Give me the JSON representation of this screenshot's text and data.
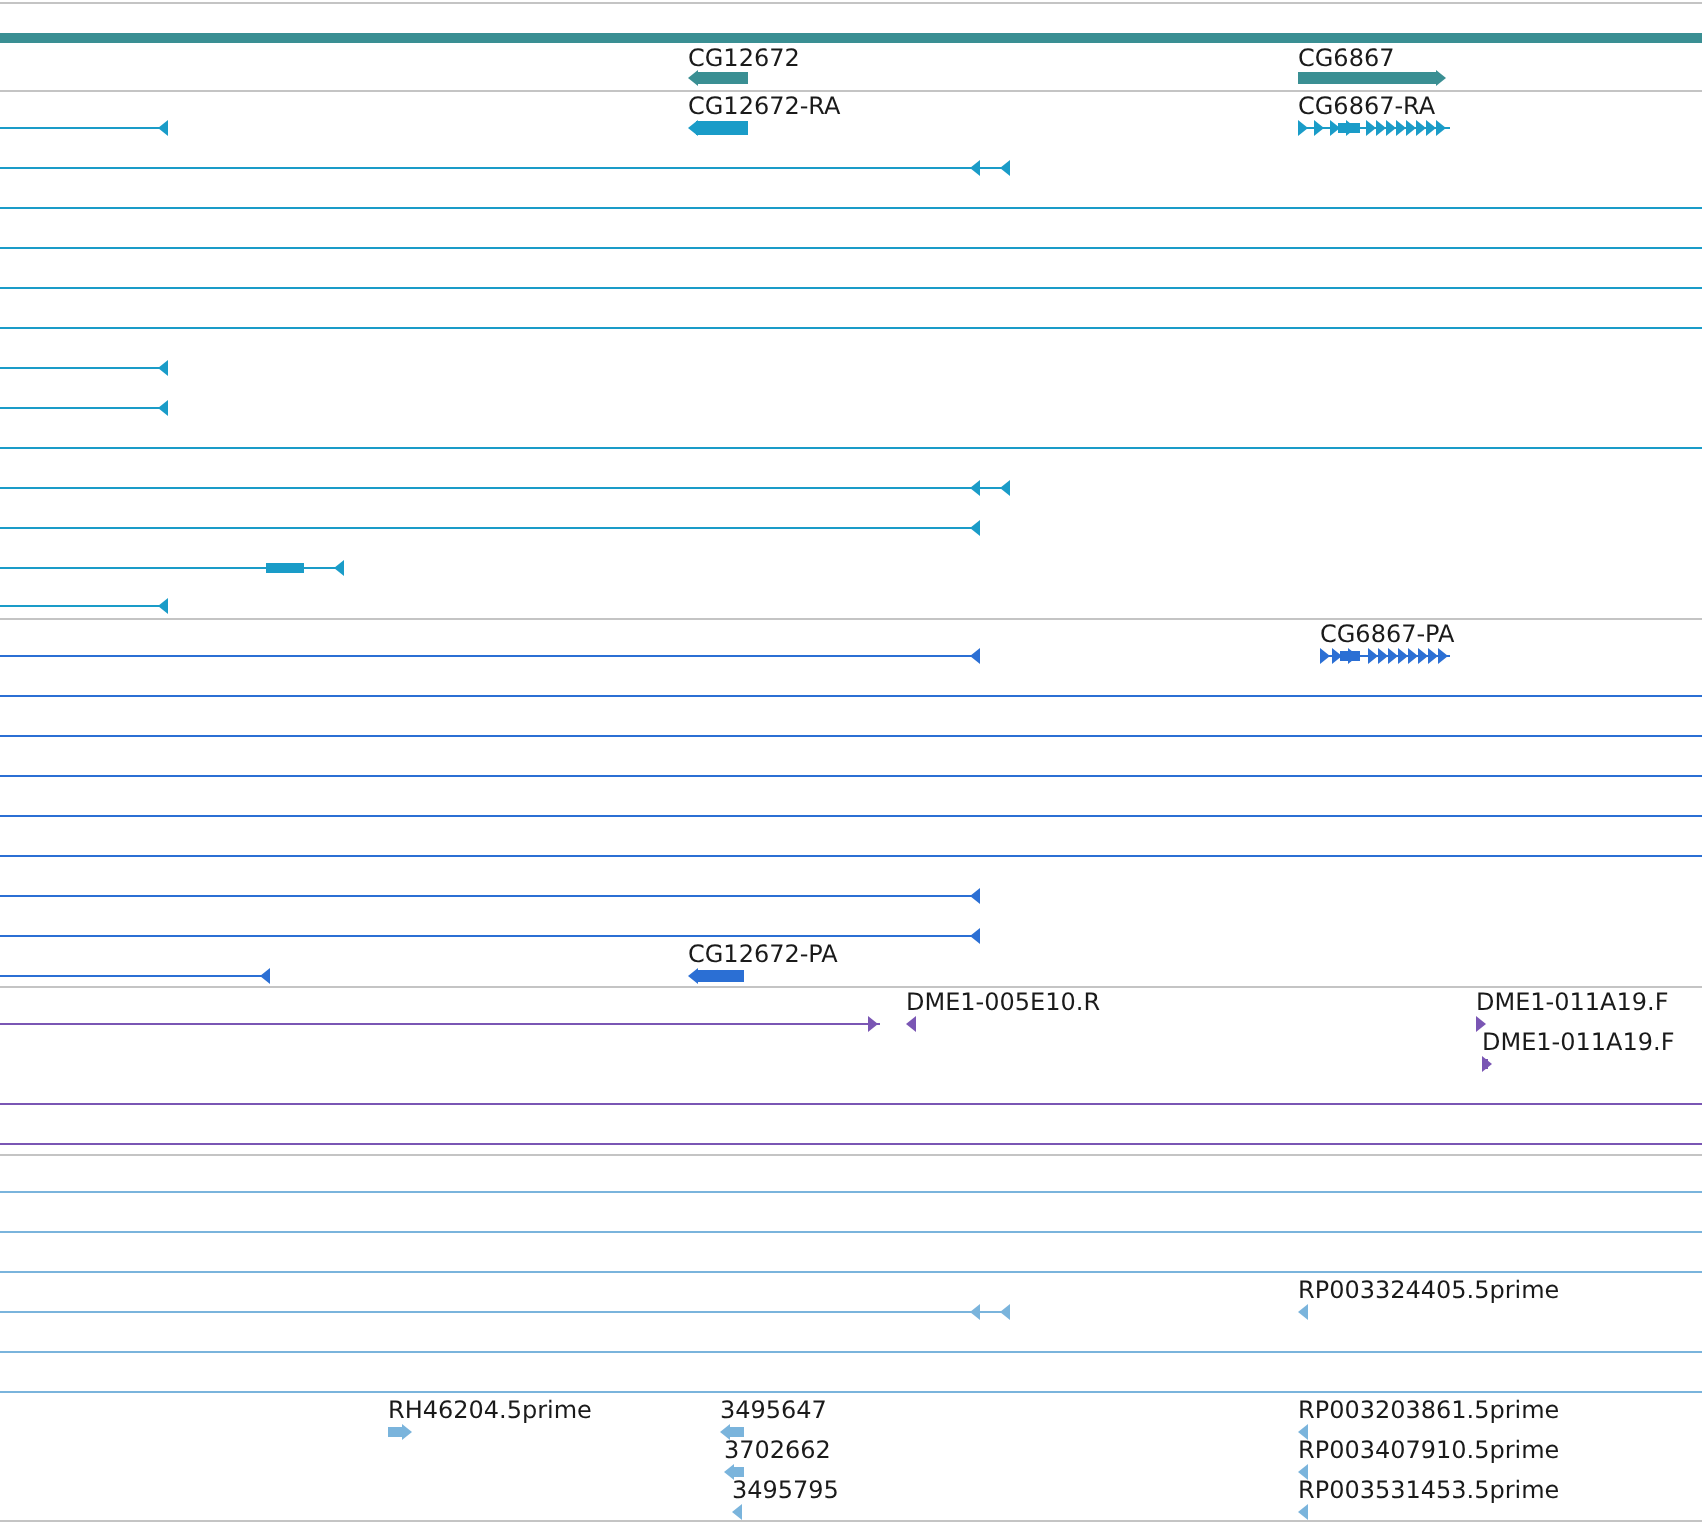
{
  "tracks": [
    {
      "color": "#3a8f93",
      "features": [
        {
          "kind": "line"
        },
        {
          "label": "CG12672",
          "kind": "minus"
        },
        {
          "label": "CG6867",
          "kind": "plus"
        }
      ]
    },
    {
      "color": "#1a9cc8",
      "features": [
        {
          "kind": "minus"
        },
        {
          "label": "CG12672-RA",
          "kind": "minus"
        },
        {
          "label": "CG6867-RA",
          "kind": "plus"
        },
        {
          "kind": "minus"
        },
        {
          "kind": "line"
        },
        {
          "kind": "line"
        },
        {
          "kind": "line"
        },
        {
          "kind": "line"
        },
        {
          "kind": "minus"
        },
        {
          "kind": "minus"
        },
        {
          "kind": "line"
        },
        {
          "kind": "minus"
        },
        {
          "kind": "minus"
        },
        {
          "kind": "minus"
        },
        {
          "kind": "minus"
        }
      ]
    },
    {
      "color": "#2b6fd4",
      "features": [
        {
          "kind": "minus"
        },
        {
          "label": "CG6867-PA",
          "kind": "plus"
        },
        {
          "kind": "line"
        },
        {
          "kind": "line"
        },
        {
          "kind": "line"
        },
        {
          "kind": "line"
        },
        {
          "kind": "line"
        },
        {
          "kind": "minus"
        },
        {
          "kind": "minus"
        },
        {
          "kind": "minus"
        },
        {
          "label": "CG12672-PA",
          "kind": "minus"
        }
      ]
    },
    {
      "color": "#7a56b4",
      "features": [
        {
          "kind": "plus"
        },
        {
          "label": "DME1-005E10.R",
          "kind": "minus"
        },
        {
          "label": "DME1-011A19.F",
          "kind": "plus"
        },
        {
          "label": "DME1-011A19.F",
          "kind": "plus"
        },
        {
          "kind": "line"
        },
        {
          "kind": "line"
        }
      ]
    },
    {
      "color": "#7ab4dc",
      "features": [
        {
          "kind": "line"
        },
        {
          "kind": "line"
        },
        {
          "kind": "line"
        },
        {
          "kind": "minus"
        },
        {
          "label": "RP003324405.5prime",
          "kind": "minus"
        },
        {
          "kind": "line"
        },
        {
          "kind": "line"
        },
        {
          "label": "RH46204.5prime",
          "kind": "plus"
        },
        {
          "label": "3495647",
          "kind": "minus"
        },
        {
          "label": "RP003203861.5prime",
          "kind": "minus"
        },
        {
          "label": "3702662",
          "kind": "minus"
        },
        {
          "label": "RP003407910.5prime",
          "kind": "minus"
        },
        {
          "label": "3495795",
          "kind": "minus"
        },
        {
          "label": "RP003531453.5prime",
          "kind": "minus"
        }
      ]
    }
  ]
}
